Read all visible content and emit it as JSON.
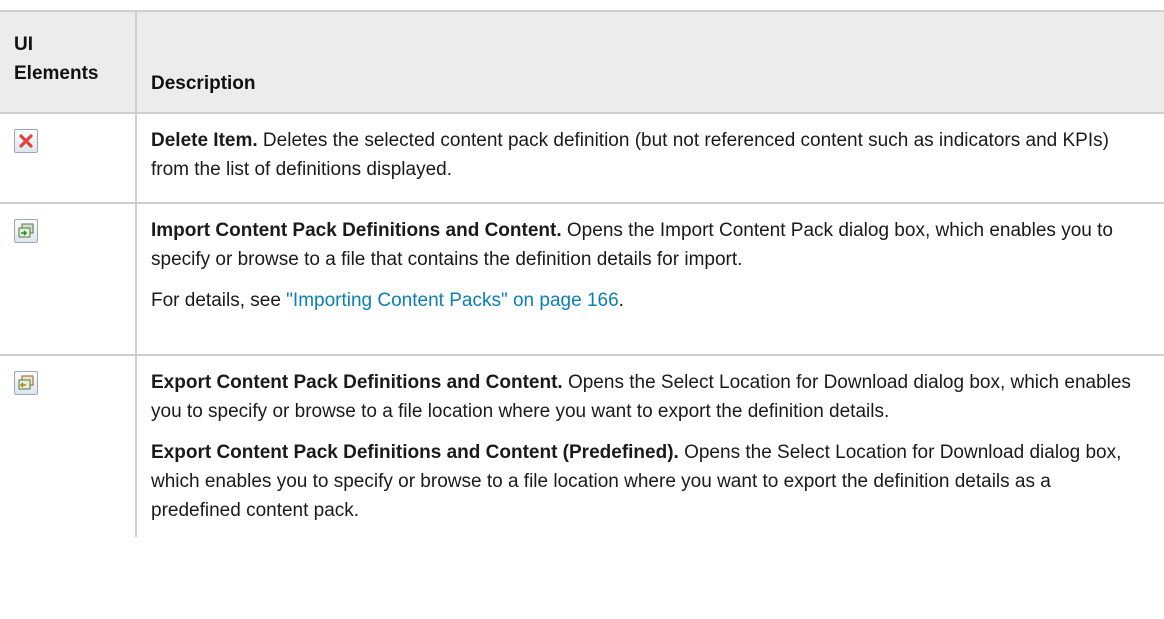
{
  "header": {
    "col1": "UI Elements",
    "col1_line1": "UI",
    "col1_line2": "Elements",
    "col2": "Description"
  },
  "rows": [
    {
      "icon": "delete-icon",
      "title": "Delete Item.",
      "text": " Deletes the selected content pack definition (but not referenced content such as indicators and KPIs) from the list of definitions displayed."
    },
    {
      "icon": "import-icon",
      "title": "Import Content Pack Definitions and Content.",
      "text": " Opens the Import Content Pack dialog box, which enables you to specify or browse to a file that contains the definition details for import.",
      "details_prefix": "For details, see ",
      "details_link": "\"Importing Content Packs\" on page 166",
      "details_suffix": "."
    },
    {
      "icon": "export-icon",
      "title": "Export Content Pack Definitions and Content.",
      "text": " Opens the Select Location for Download dialog box, which enables you to specify or browse to a file location where you want to export the definition details.",
      "title2": "Export Content Pack Definitions and Content (Predefined).",
      "text2": " Opens the Select Location for Download dialog box, which enables you to specify or browse to a file location where you want to export the definition details as a predefined content pack."
    }
  ],
  "colors": {
    "link": "#0a7fb5",
    "header_bg": "#ececec",
    "delete_icon": "#e0443a"
  }
}
